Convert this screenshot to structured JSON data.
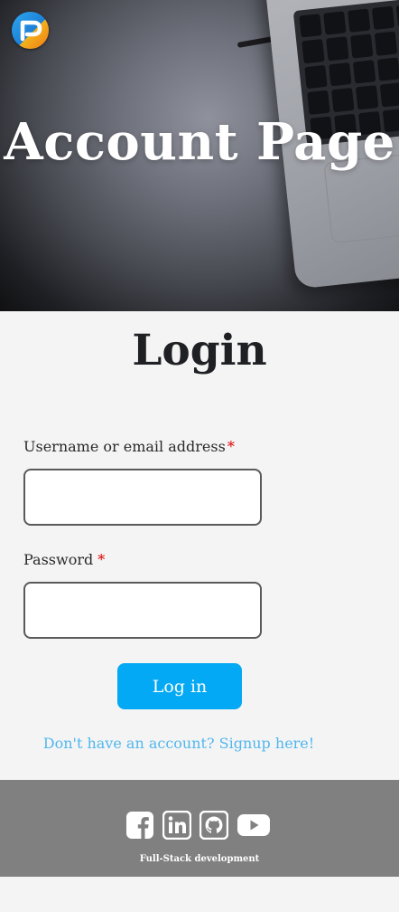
{
  "header": {
    "logo_icon": "brand-logo-icon",
    "title": "Account Page"
  },
  "login": {
    "heading": "Login",
    "username_label": "Username or email address",
    "username_value": "",
    "password_label": "Password",
    "password_value": "",
    "required_mark": "*",
    "submit_label": "Log in",
    "signup_link": "Don't have an account? Signup here!"
  },
  "footer": {
    "social_icons": [
      "facebook-icon",
      "linkedin-icon",
      "github-icon",
      "youtube-icon"
    ],
    "text": "Full-Stack development"
  },
  "colors": {
    "accent": "#03a9f4",
    "link": "#52b7ee",
    "required": "#e00000",
    "footer_bg": "#808080",
    "page_bg": "#f4f4f4"
  }
}
